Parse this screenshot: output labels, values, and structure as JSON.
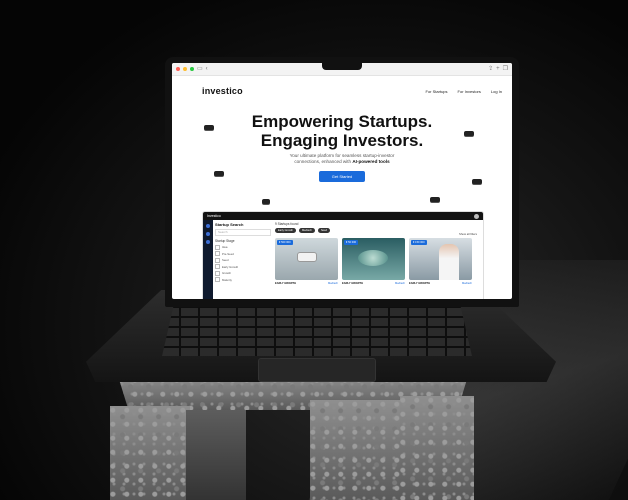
{
  "browser": {
    "icons": [
      "sidebar-icon",
      "back-icon",
      "share-icon",
      "new-tab-icon",
      "tabs-icon"
    ]
  },
  "nav": {
    "logo": "investico",
    "links": [
      "For Startups",
      "For Investors",
      "Log In"
    ]
  },
  "hero": {
    "title_line1": "Empowering Startups.",
    "title_line2": "Engaging Investors.",
    "subtitle_line1": "Your ultimate platform for seamless startup-investor",
    "subtitle_line2_prefix": "connections, enhanced with ",
    "subtitle_line2_bold": "AI-powered tools",
    "cta": "Get Started"
  },
  "app": {
    "title": "Investico",
    "sidebar": {
      "heading": "Startup Search",
      "search_placeholder": "Search",
      "filter_title": "Startup Stage",
      "options": [
        "Idea",
        "Pre-Seed",
        "Seed",
        "Early Growth",
        "Growth",
        "Maturity"
      ]
    },
    "results_label": "9 Startups found",
    "tags": [
      "Early Growth",
      "Medtech",
      "Seed"
    ],
    "sort_label": "Show all filters",
    "cards": [
      {
        "price": "€ 500 000",
        "stage": "EARLY GROWTH",
        "category": "Medtech"
      },
      {
        "price": "€ 50 000",
        "stage": "EARLY GROWTH",
        "category": "Medtech"
      },
      {
        "price": "€ 150 000",
        "stage": "EARLY GROWTH",
        "category": "Medtech"
      }
    ]
  },
  "colors": {
    "accent": "#1a6bdb",
    "dark": "#121212",
    "background": "#050505"
  }
}
